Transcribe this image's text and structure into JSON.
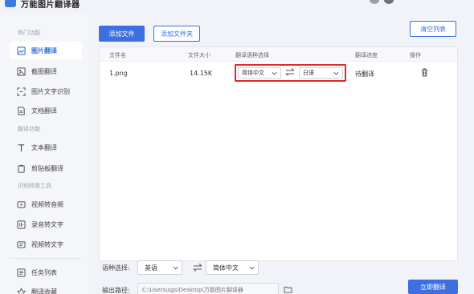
{
  "app": {
    "title": "万能图片翻译器"
  },
  "sidebar": {
    "sections": [
      {
        "title": "热门功能",
        "items": [
          {
            "label": "图片翻译",
            "icon": "image-translate-icon",
            "active": true
          },
          {
            "label": "截图翻译",
            "icon": "screenshot-icon"
          },
          {
            "label": "图片文字识别",
            "icon": "ocr-icon"
          },
          {
            "label": "文档翻译",
            "icon": "document-icon"
          }
        ]
      },
      {
        "title": "翻译功能",
        "items": [
          {
            "label": "文本翻译",
            "icon": "text-icon"
          },
          {
            "label": "剪贴板翻译",
            "icon": "clipboard-icon"
          }
        ]
      },
      {
        "title": "识别转换工具",
        "items": [
          {
            "label": "视频转音频",
            "icon": "video-audio-icon"
          },
          {
            "label": "录音转文字",
            "icon": "audio-text-icon"
          },
          {
            "label": "视频转文字",
            "icon": "video-text-icon"
          }
        ]
      },
      {
        "title": "",
        "items": [
          {
            "label": "任务列表",
            "icon": "task-list-icon"
          },
          {
            "label": "翻译收藏",
            "icon": "favorite-icon"
          }
        ]
      }
    ]
  },
  "toolbar": {
    "add_file": "添加文件",
    "add_folder": "添加文件夹",
    "clear_list": "清空列表"
  },
  "table": {
    "headers": {
      "name": "文件名",
      "size": "文件大小",
      "lang": "翻译语种选择",
      "progress": "翻译进度",
      "action": "操作"
    },
    "rows": [
      {
        "name": "1.png",
        "size": "14.15K",
        "source_lang": "简体中文",
        "target_lang": "日语",
        "status": "待翻译"
      }
    ]
  },
  "bottom": {
    "lang_label": "语种选择:",
    "source_lang": "英语",
    "target_lang": "简体中文",
    "output_label": "输出路径:",
    "output_path": "C:\\Users\\sgs\\Desktop\\万能图片翻译器",
    "start_button": "立即翻译"
  },
  "colors": {
    "primary": "#3e6fe0",
    "highlight": "#e02b2b",
    "sidebar_bg": "#f5f6fa",
    "main_bg": "#f1f3f8"
  }
}
